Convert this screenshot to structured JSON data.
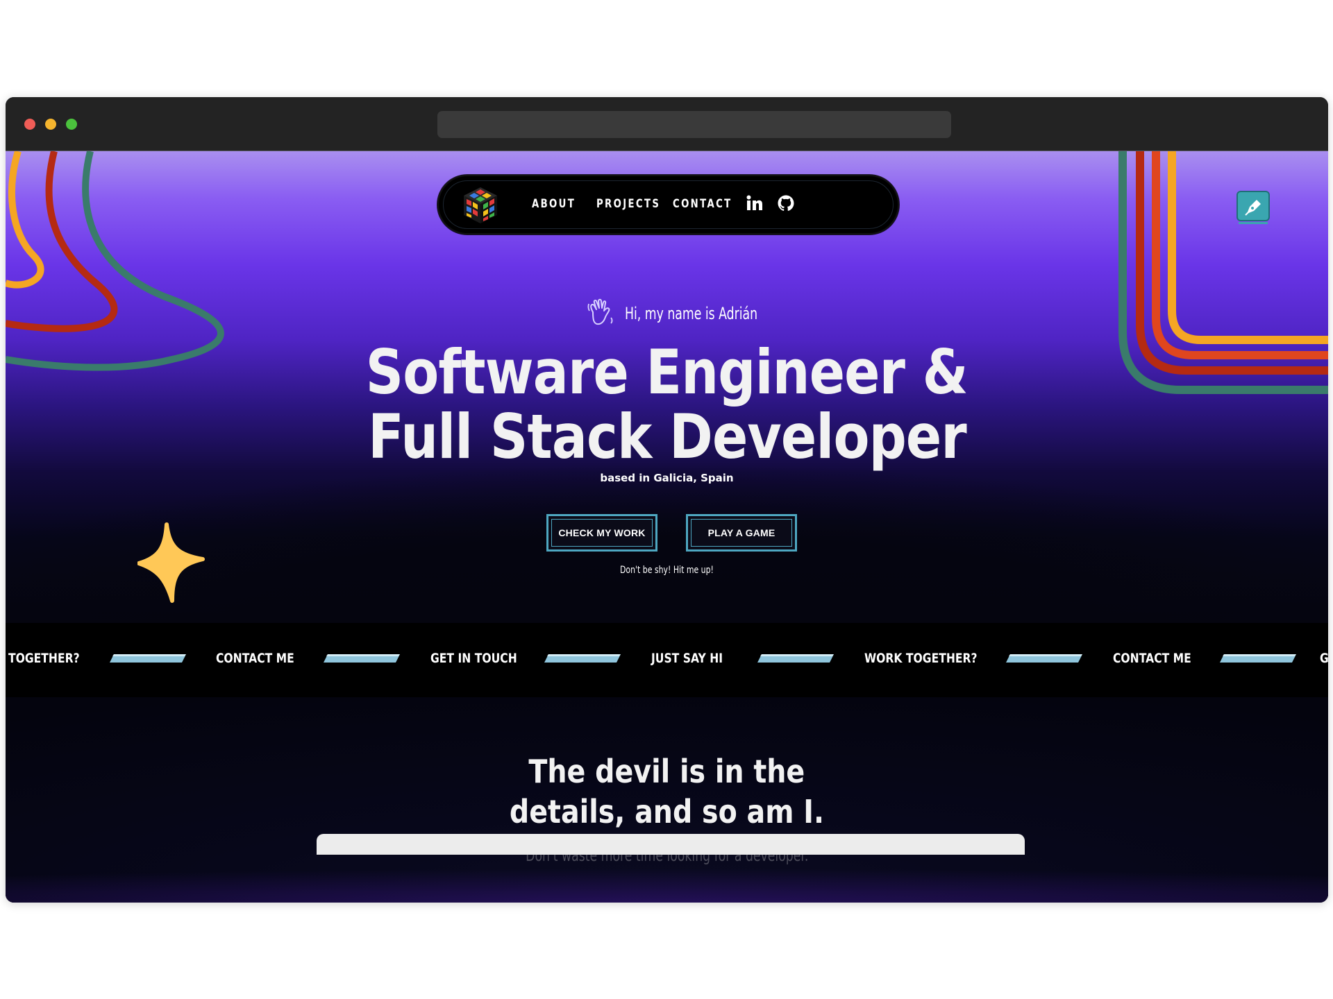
{
  "nav": {
    "links": [
      "ABOUT",
      "PROJECTS",
      "CONTACT"
    ],
    "icons": [
      "linkedin-icon",
      "github-icon"
    ]
  },
  "hero": {
    "greeting": "Hi, my name is Adrián",
    "headline_line1": "Software Engineer &",
    "headline_line2": "Full Stack Developer",
    "location": "based in Galicia, Spain",
    "buttons": [
      "CHECK MY WORK",
      "PLAY A GAME"
    ],
    "tagline": "Don't be shy! Hit me up!"
  },
  "marquee": {
    "items": [
      "TOGETHER?",
      "CONTACT ME",
      "GET IN TOUCH",
      "JUST SAY HI",
      "WORK TOGETHER?",
      "CONTACT ME",
      "G"
    ]
  },
  "section2": {
    "title_line1": "The devil is in the",
    "title_line2": "details, and so am I.",
    "subtitle": "Don't waste more time looking for a developer."
  },
  "colors": {
    "accent_teal": "#4ea7c1",
    "purple": "#6a35e8",
    "star": "#ffc857",
    "stripe_orange": "#f5a623",
    "stripe_red": "#b52a12",
    "stripe_green": "#3a7b6b"
  }
}
